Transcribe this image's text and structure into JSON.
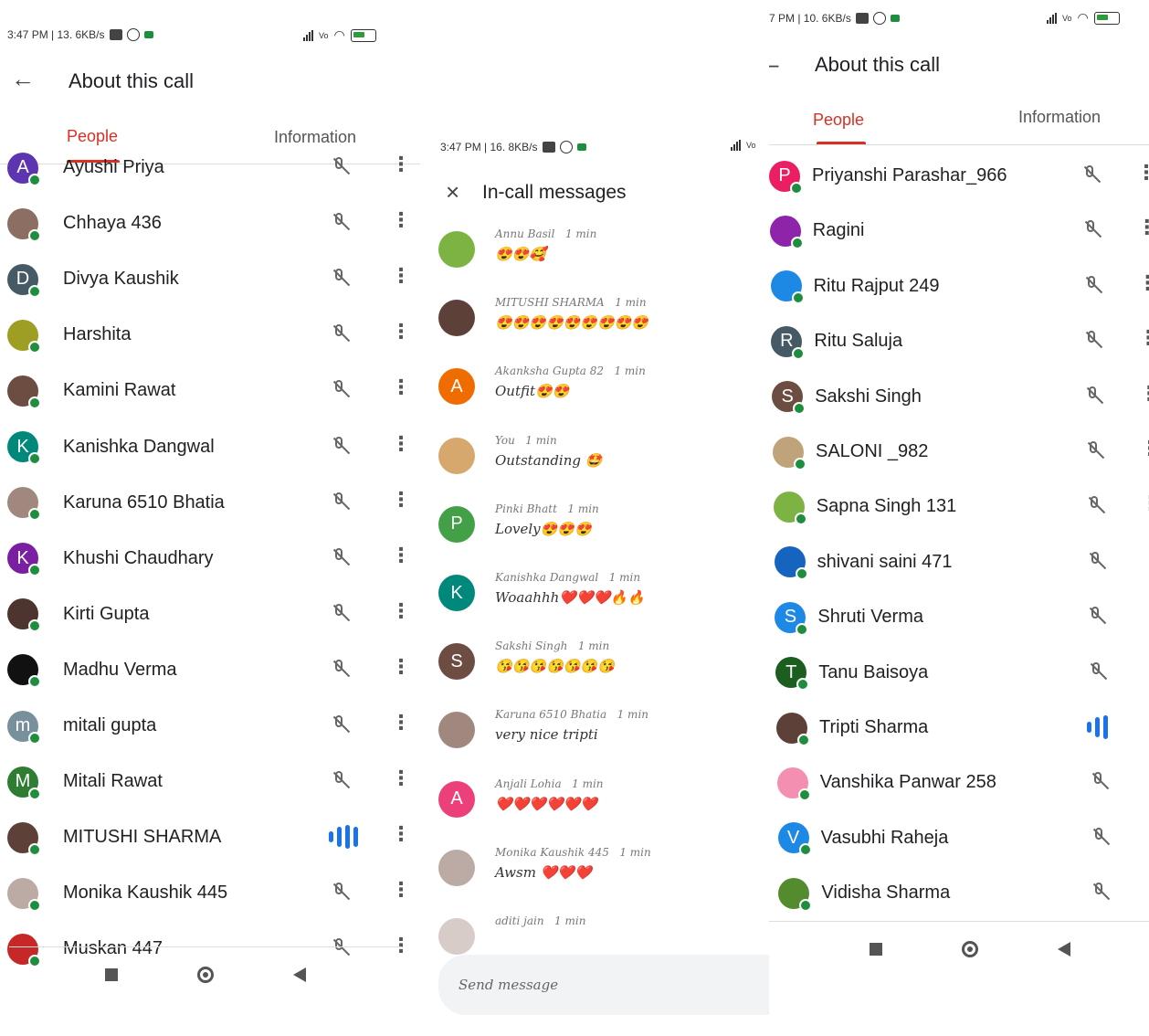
{
  "left": {
    "status_time": "3:47 PM | 13. 6KB/s",
    "title": "About this call",
    "tabs": [
      "People",
      "Information"
    ],
    "participants": [
      {
        "name": "Ayushi Priya",
        "initial": "A",
        "color": "#5e35b1",
        "speaking": false
      },
      {
        "name": "Chhaya 436",
        "initial": "",
        "color": "#8d6e63",
        "speaking": false
      },
      {
        "name": "Divya Kaushik",
        "initial": "D",
        "color": "#455a64",
        "speaking": false
      },
      {
        "name": "Harshita",
        "initial": "",
        "color": "#9e9d24",
        "speaking": false
      },
      {
        "name": "Kamini Rawat",
        "initial": "",
        "color": "#6d4c41",
        "speaking": false
      },
      {
        "name": "Kanishka Dangwal",
        "initial": "K",
        "color": "#00897b",
        "speaking": false
      },
      {
        "name": "Karuna 6510 Bhatia",
        "initial": "",
        "color": "#a1887f",
        "speaking": false
      },
      {
        "name": "Khushi Chaudhary",
        "initial": "K",
        "color": "#7b1fa2",
        "speaking": false
      },
      {
        "name": "Kirti Gupta",
        "initial": "",
        "color": "#4e342e",
        "speaking": false
      },
      {
        "name": "Madhu Verma",
        "initial": "",
        "color": "#111111",
        "speaking": false
      },
      {
        "name": "mitali gupta",
        "initial": "m",
        "color": "#78909c",
        "speaking": false
      },
      {
        "name": "Mitali Rawat",
        "initial": "M",
        "color": "#2e7d32",
        "speaking": false
      },
      {
        "name": "MITUSHI SHARMA",
        "initial": "",
        "color": "#5d4037",
        "speaking": true
      },
      {
        "name": "Monika Kaushik 445",
        "initial": "",
        "color": "#bcaaa4",
        "speaking": false
      },
      {
        "name": "Muskan 447",
        "initial": "",
        "color": "#c62828",
        "speaking": false
      }
    ]
  },
  "middle": {
    "status_time": "3:47 PM | 16. 8KB/s",
    "title": "In-call messages",
    "send_placeholder": "Send message",
    "messages": [
      {
        "author": "Annu Basil",
        "time": "1 min",
        "text": "😍😍🥰",
        "initial": "",
        "color": "#7cb342"
      },
      {
        "author": "MITUSHI SHARMA",
        "time": "1 min",
        "text": "😍😍😍😍😍😍😍😍😍",
        "initial": "",
        "color": "#5d4037"
      },
      {
        "author": "Akanksha Gupta 82",
        "time": "1 min",
        "text": "Outfit😍😍",
        "initial": "A",
        "color": "#ef6c00"
      },
      {
        "author": "You",
        "time": "1 min",
        "text": "Outstanding 🤩",
        "initial": "",
        "color": "#d7a86e"
      },
      {
        "author": "Pinki Bhatt",
        "time": "1 min",
        "text": "Lovely😍😍😍",
        "initial": "P",
        "color": "#43a047"
      },
      {
        "author": "Kanishka Dangwal",
        "time": "1 min",
        "text": "Woaahhh❤️❤️❤️🔥🔥",
        "initial": "K",
        "color": "#00897b"
      },
      {
        "author": "Sakshi Singh",
        "time": "1 min",
        "text": "😘😘😘😘😘😘😘",
        "initial": "S",
        "color": "#6d4c41"
      },
      {
        "author": "Karuna 6510 Bhatia",
        "time": "1 min",
        "text": "very nice tripti",
        "initial": "",
        "color": "#a1887f"
      },
      {
        "author": "Anjali Lohia",
        "time": "1 min",
        "text": "❤️❤️❤️❤️❤️❤️",
        "initial": "A",
        "color": "#ec407a"
      },
      {
        "author": "Monika Kaushik 445",
        "time": "1 min",
        "text": "Awsm ❤️❤️❤️",
        "initial": "",
        "color": "#bcaaa4"
      },
      {
        "author": "aditi jain",
        "time": "1 min",
        "text": "",
        "initial": "",
        "color": "#d7ccc8"
      }
    ]
  },
  "right": {
    "status_time": "7 PM | 10. 6KB/s",
    "title": "About this call",
    "tabs": [
      "People",
      "Information"
    ],
    "participants": [
      {
        "name": "Priyanshi Parashar_966",
        "initial": "P",
        "color": "#e91e63",
        "speaking": false
      },
      {
        "name": "Ragini",
        "initial": "",
        "color": "#8e24aa",
        "speaking": false
      },
      {
        "name": "Ritu Rajput 249",
        "initial": "",
        "color": "#1e88e5",
        "speaking": false
      },
      {
        "name": "Ritu Saluja",
        "initial": "R",
        "color": "#455a64",
        "speaking": false
      },
      {
        "name": "Sakshi Singh",
        "initial": "S",
        "color": "#6d4c41",
        "speaking": false
      },
      {
        "name": "SALONI _982",
        "initial": "",
        "color": "#bfa37a",
        "speaking": false
      },
      {
        "name": "Sapna Singh 131",
        "initial": "",
        "color": "#7cb342",
        "speaking": false
      },
      {
        "name": "shivani saini 471",
        "initial": "",
        "color": "#1565c0",
        "speaking": false
      },
      {
        "name": "Shruti Verma",
        "initial": "S",
        "color": "#1e88e5",
        "speaking": false
      },
      {
        "name": "Tanu Baisoya",
        "initial": "T",
        "color": "#1b5e20",
        "speaking": false
      },
      {
        "name": "Tripti Sharma",
        "initial": "",
        "color": "#5d4037",
        "speaking": true
      },
      {
        "name": "Vanshika Panwar 258",
        "initial": "",
        "color": "#f48fb1",
        "speaking": false
      },
      {
        "name": "Vasubhi Raheja",
        "initial": "V",
        "color": "#1e88e5",
        "speaking": false
      },
      {
        "name": "Vidisha Sharma",
        "initial": "",
        "color": "#558b2f",
        "speaking": false
      }
    ]
  }
}
